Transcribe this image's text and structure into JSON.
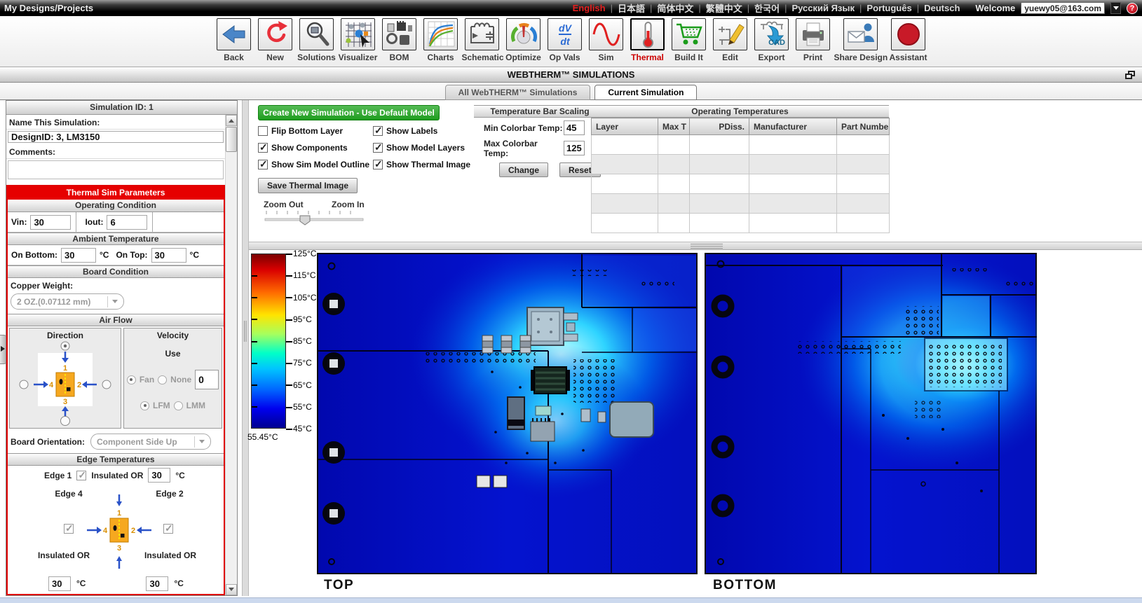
{
  "icons": {
    "help_q": "?",
    "assistant_q": "?"
  },
  "top_bar": {
    "title": "My Designs/Projects",
    "languages": [
      "English",
      "日本語",
      "简体中文",
      "繁體中文",
      "한국어",
      "Русский Язык",
      "Português",
      "Deutsch"
    ],
    "separator": "|",
    "welcome_label": "Welcome",
    "account": "yuewy05@163.com"
  },
  "toolbar": {
    "items": [
      {
        "label": "Back"
      },
      {
        "label": "New"
      },
      {
        "label": "Solutions"
      },
      {
        "label": "Visualizer"
      },
      {
        "label": "BOM"
      },
      {
        "label": "Charts"
      },
      {
        "label": "Schematic"
      },
      {
        "label": "Optimize"
      },
      {
        "label": "Op Vals"
      },
      {
        "label": "Sim"
      },
      {
        "label": "Thermal",
        "active": true
      },
      {
        "label": "Build It"
      },
      {
        "label": "Edit"
      },
      {
        "label": "Export"
      },
      {
        "label": "Print"
      },
      {
        "label": "Share Design"
      },
      {
        "label": "Assistant"
      }
    ],
    "opvals_top": "dV",
    "opvals_bottom": "dt",
    "export_cad": "CAD"
  },
  "header": {
    "title": "WEBTHERM™ SIMULATIONS"
  },
  "tabs": {
    "all_label": "All WebTHERM™ Simulations",
    "current_label": "Current Simulation"
  },
  "left_panel": {
    "header": "Simulation ID: 1",
    "name_label": "Name This Simulation:",
    "name_value": "DesignID: 3, LM3150",
    "comments_label": "Comments:",
    "comments_value": "",
    "thermal_params_header": "Thermal Sim Parameters",
    "operating_condition": {
      "header": "Operating Condition",
      "vin_label": "Vin:",
      "vin": "30",
      "iout_label": "Iout:",
      "iout": "6"
    },
    "ambient": {
      "header": "Ambient Temperature",
      "on_bottom_label": "On Bottom:",
      "on_bottom": "30",
      "on_top_label": "On Top:",
      "on_top": "30",
      "unit": "°C"
    },
    "board_condition": {
      "header": "Board Condition",
      "copper_label": "Copper Weight:",
      "copper_value": "2 OZ.(0.07112 mm)"
    },
    "air_flow": {
      "header": "Air Flow",
      "direction_label": "Direction",
      "velocity_label": "Velocity",
      "use_label": "Use",
      "fan_label": "Fan",
      "none_label": "None",
      "velocity_value": "0",
      "lfm_label": "LFM",
      "lmm_label": "LMM"
    },
    "direction_numbers": {
      "n1": "1",
      "n2": "2",
      "n3": "3",
      "n4": "4"
    },
    "board_orientation": {
      "label": "Board Orientation:",
      "value": "Component Side Up"
    },
    "edge_temps": {
      "header": "Edge Temperatures",
      "edge1_label": "Edge 1",
      "insulated_label": "Insulated OR",
      "unit": "°C",
      "edge1_temp": "30",
      "edge4_label": "Edge 4",
      "edge2_label": "Edge 2",
      "edge4_temp": "30",
      "edge2_temp": "30"
    }
  },
  "sim_controls": {
    "create_button": "Create New Simulation - Use Default Model",
    "checkboxes": [
      {
        "label": "Flip Bottom Layer",
        "checked": false
      },
      {
        "label": "Show Labels",
        "checked": true
      },
      {
        "label": "Show Components",
        "checked": true
      },
      {
        "label": "Show Model Layers",
        "checked": true
      },
      {
        "label": "Show Sim Model Outline",
        "checked": true
      },
      {
        "label": "Show Thermal Image",
        "checked": true
      }
    ],
    "save_button": "Save Thermal Image",
    "zoom_out_label": "Zoom Out",
    "zoom_in_label": "Zoom In"
  },
  "temp_scaling": {
    "header": "Temperature Bar Scaling",
    "min_label": "Min Colorbar Temp:",
    "min_value": "45",
    "max_label": "Max Colorbar Temp:",
    "max_value": "125",
    "change_button": "Change",
    "reset_button": "Reset"
  },
  "operating_temps": {
    "header": "Operating Temperatures",
    "columns": [
      "Layer",
      "Max T",
      "PDiss.",
      "Manufacturer",
      "Part Number"
    ],
    "row_count": 5
  },
  "thermal_view": {
    "colorbar_ticks": [
      "125°C",
      "115°C",
      "105°C",
      "95°C",
      "85°C",
      "75°C",
      "65°C",
      "55°C",
      "45°C"
    ],
    "current_min_temp": "55.45°C",
    "top_label": "TOP",
    "bottom_label": "BOTTOM",
    "colors": {
      "hot": "#7a0000",
      "cold": "#000090",
      "hotspot": "#c2ffff",
      "board": "#0413cf"
    }
  }
}
